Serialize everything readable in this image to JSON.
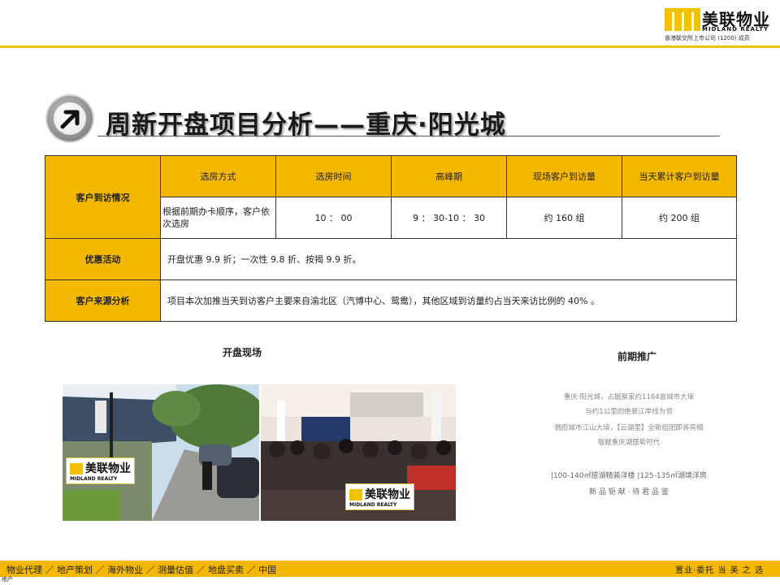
{
  "header": {
    "logo_cn": "美联物业",
    "logo_en": "MIDLAND REALTY",
    "logo_sub": "香港联交所上市公司 (1200) 成员"
  },
  "page_title": "周新开盘项目分析——重庆·阳光城",
  "table": {
    "visit_label": "客户到访情况",
    "headers": [
      "选房方式",
      "选房时间",
      "高峰期",
      "现场客户到访量",
      "当天累计客户到访量"
    ],
    "values": [
      "根据前期办卡顺序，客户依次选房",
      "10 ： 00",
      "9 ： 30-10 ： 30",
      "约 160 组",
      "约 200 组"
    ],
    "promo_label": "优惠活动",
    "promo_text": "开盘优惠 9.9 折；一次性 9.8 折、按揭 9.9 折。",
    "source_label": "客户来源分析",
    "source_text": "项目本次加推当天到访客户主要来自渝北区（汽博中心、鸳鸯），其他区域到访量约占当天来访比例的 40% 。"
  },
  "sections": {
    "opening": "开盘现场",
    "promotion": "前期推广"
  },
  "promo_panel": {
    "lines": [
      "重庆·阳光城，占据蔡家约1164亩城市大境",
      "与约1公里的绝景江岸线为邻",
      "拥揽城市江山大境，【云湖里】全新组团即将亮相",
      "敬献重庆湖居新时代"
    ],
    "bold_line": "|100-140㎡揽湖精装洋楼  |125-135㎡湖境洋房",
    "tagline": "新 品 钜 献 · 待 君 品 鉴"
  },
  "watermark": {
    "cn": "美联物业",
    "en": "MIDLAND REALTY"
  },
  "footer": {
    "nav": "物业代理 ／ 地产策划 ／ 海外物业 ／ 测量估值 ／ 地盘买卖 ／ 中国",
    "slogan": "置业·委托  当  美  之  选",
    "small": "地产"
  },
  "colors": {
    "brand_yellow": "#f5b800",
    "rule_yellow": "#f2c200"
  }
}
